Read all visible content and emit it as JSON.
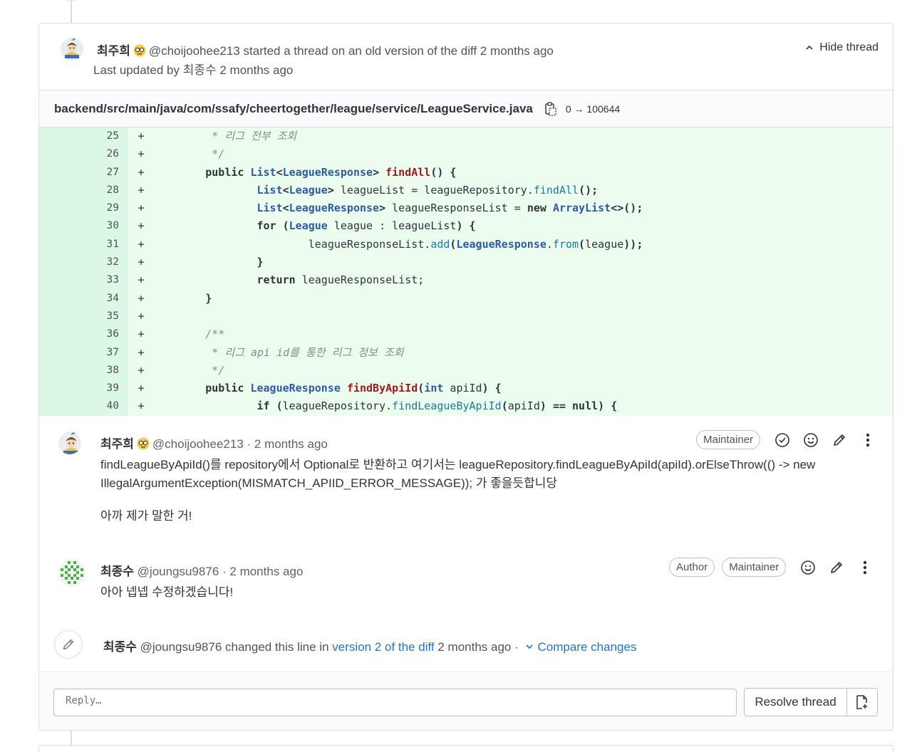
{
  "thread_header": {
    "author_name": "최주희",
    "author_handle": "@choijoohee213",
    "action_text": "started a thread on an old version of the diff",
    "time": "2 months ago",
    "updated_prefix": "Last updated by",
    "updated_by": "최종수",
    "updated_time": "2 months ago",
    "hide_label": "Hide thread"
  },
  "file": {
    "path": "backend/src/main/java/com/ssafy/cheertogether/league/service/LeagueService.java",
    "mode": "0 → 100644"
  },
  "diff": {
    "sign": "+",
    "line_numbers": [
      "25",
      "26",
      "27",
      "28",
      "29",
      "30",
      "31",
      "32",
      "33",
      "34",
      "35",
      "36",
      "37",
      "38",
      "39",
      "40"
    ]
  },
  "notes": [
    {
      "author_name": "최주희",
      "meta": "@choijoohee213 · 2 months ago",
      "badges": [
        "Maintainer"
      ],
      "body_1": "findLeagueByApiId()를 repository에서 Optional로 반환하고 여기서는 leagueRepository.findLeagueByApiId(apiId).orElseThrow(() -> new IllegalArgumentException(MISMATCH_APIID_ERROR_MESSAGE)); 가 좋을듯합니당",
      "body_2": "아까 제가 말한 거!"
    },
    {
      "author_name": "최종수",
      "meta": "@joungsu9876 · 2 months ago",
      "badges": [
        "Author",
        "Maintainer"
      ],
      "body_1": "아아 넵넵 수정하겠습니다!"
    }
  ],
  "system_note": {
    "author_name": "최종수",
    "text_before": "@joungsu9876 changed this line in",
    "link": "version 2 of the diff",
    "text_after": "2 months ago ·",
    "compare": "Compare changes"
  },
  "reply": {
    "placeholder": "Reply…",
    "resolve_label": "Resolve thread"
  },
  "colors": {
    "diff_added_bg": "#ecfdf0",
    "diff_added_gutter": "#dbf7e5",
    "link": "#1f75cb"
  }
}
